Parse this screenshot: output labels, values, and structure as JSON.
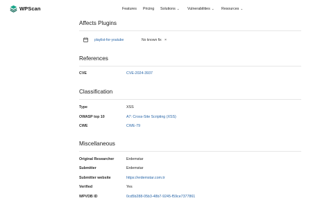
{
  "brand": {
    "name": "WPScan"
  },
  "nav": {
    "features": "Features",
    "pricing": "Pricing",
    "solutions": "Solutions",
    "vulnerabilities": "Vulnerabilities",
    "resources": "Resources"
  },
  "plugins": {
    "title": "Affects Plugins",
    "items": [
      {
        "name": "playlist-for-youtube",
        "status": "No known fix"
      }
    ]
  },
  "references": {
    "title": "References",
    "rows": [
      {
        "label": "CVE",
        "value": "CVE-2024-3937"
      }
    ]
  },
  "classification": {
    "title": "Classification",
    "rows": [
      {
        "label": "Type",
        "value": "XSS"
      },
      {
        "label": "OWASP top 10",
        "value": "A7: Cross-Site Scripting (XSS)"
      },
      {
        "label": "CWE",
        "value": "CWE-79"
      }
    ]
  },
  "misc": {
    "title": "Miscellaneous",
    "rows": [
      {
        "label": "Original Researcher",
        "value": "Erdemstar"
      },
      {
        "label": "Submitter",
        "value": "Erdemstar"
      },
      {
        "label": "Submitter website",
        "value": "https://erdemstar.com.tr"
      },
      {
        "label": "Verified",
        "value": "Yes"
      },
      {
        "label": "WPVDB ID",
        "value": "0cd5b288-05b3-48b7-9245-f59ce7377861"
      }
    ]
  },
  "colors": {
    "link": "#2563a6",
    "brand": "#0f9d8a"
  }
}
